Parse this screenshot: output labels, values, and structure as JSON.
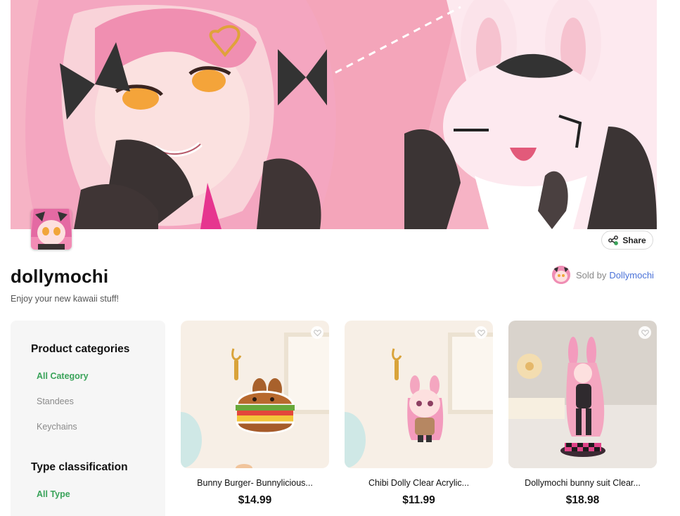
{
  "banner": {
    "alt_icon": "store-banner-illustration"
  },
  "share": {
    "label": "Share",
    "icon": "share-icon"
  },
  "store": {
    "name": "dollymochi",
    "tagline": "Enjoy your new kawaii stuff!"
  },
  "seller": {
    "prefix": "Sold by",
    "name": "Dollymochi"
  },
  "sidebar": {
    "product_categories": {
      "title": "Product categories",
      "items": [
        "All Category",
        "Standees",
        "Keychains"
      ],
      "active": "All Category"
    },
    "type_classification": {
      "title": "Type classification",
      "items": [
        "All Type"
      ],
      "active": "All Type"
    }
  },
  "products": [
    {
      "title": "Bunny Burger- Bunnylicious...",
      "price": "$14.99",
      "favorite_icon": "heart-icon"
    },
    {
      "title": "Chibi Dolly Clear Acrylic...",
      "price": "$11.99",
      "favorite_icon": "heart-icon"
    },
    {
      "title": "Dollymochi bunny suit Clear...",
      "price": "$18.98",
      "favorite_icon": "heart-icon"
    }
  ],
  "colors": {
    "accent_green": "#3aa35a",
    "link_blue": "#4a72d8",
    "banner_pink": "#f4a9bd"
  }
}
